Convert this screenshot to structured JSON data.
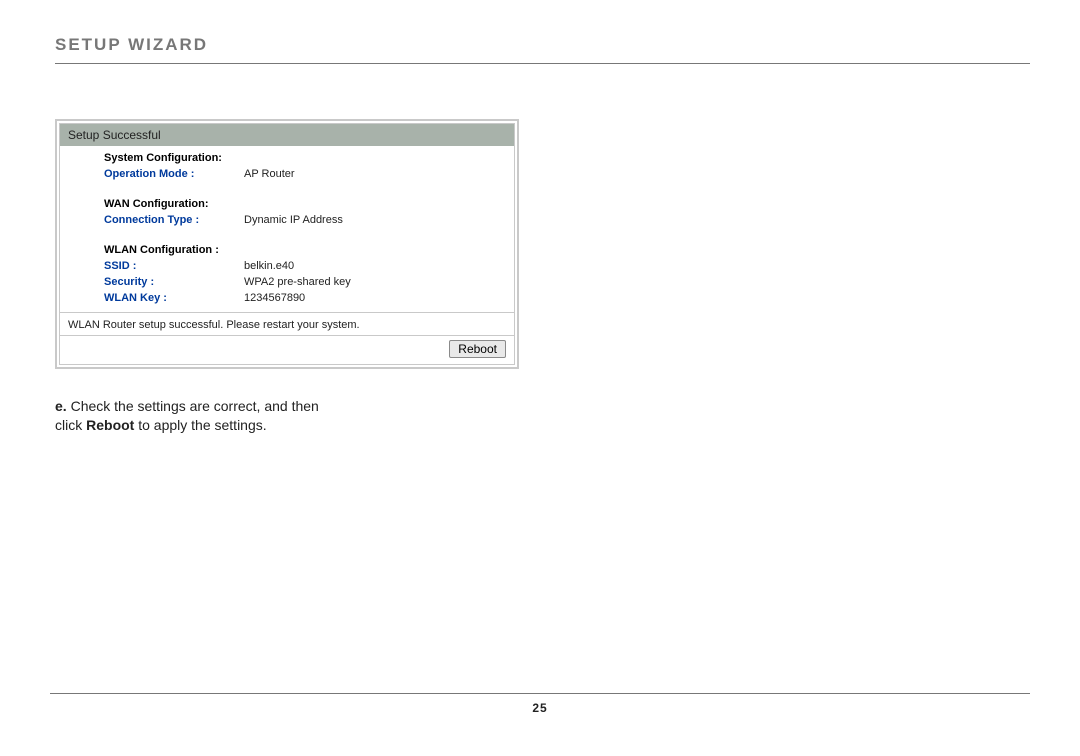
{
  "page": {
    "title": "Setup Wizard",
    "number": "25"
  },
  "panel": {
    "header": "Setup Successful",
    "system": {
      "heading": "System Configuration:",
      "operation_mode_label": "Operation Mode :",
      "operation_mode_value": "AP Router"
    },
    "wan": {
      "heading": "WAN Configuration:",
      "connection_type_label": "Connection Type :",
      "connection_type_value": "Dynamic IP Address"
    },
    "wlan": {
      "heading": "WLAN Configuration :",
      "ssid_label": "SSID :",
      "ssid_value": "belkin.e40",
      "security_label": "Security :",
      "security_value": "WPA2 pre-shared key",
      "wlan_key_label": "WLAN Key :",
      "wlan_key_value": "1234567890"
    },
    "status_message": "WLAN Router setup successful. Please restart your system.",
    "reboot_label": "Reboot"
  },
  "instruction": {
    "bullet": "e.",
    "line1": " Check the settings are correct, and then",
    "line2_prefix": "click ",
    "line2_strong": "Reboot",
    "line2_suffix": " to apply the settings."
  }
}
